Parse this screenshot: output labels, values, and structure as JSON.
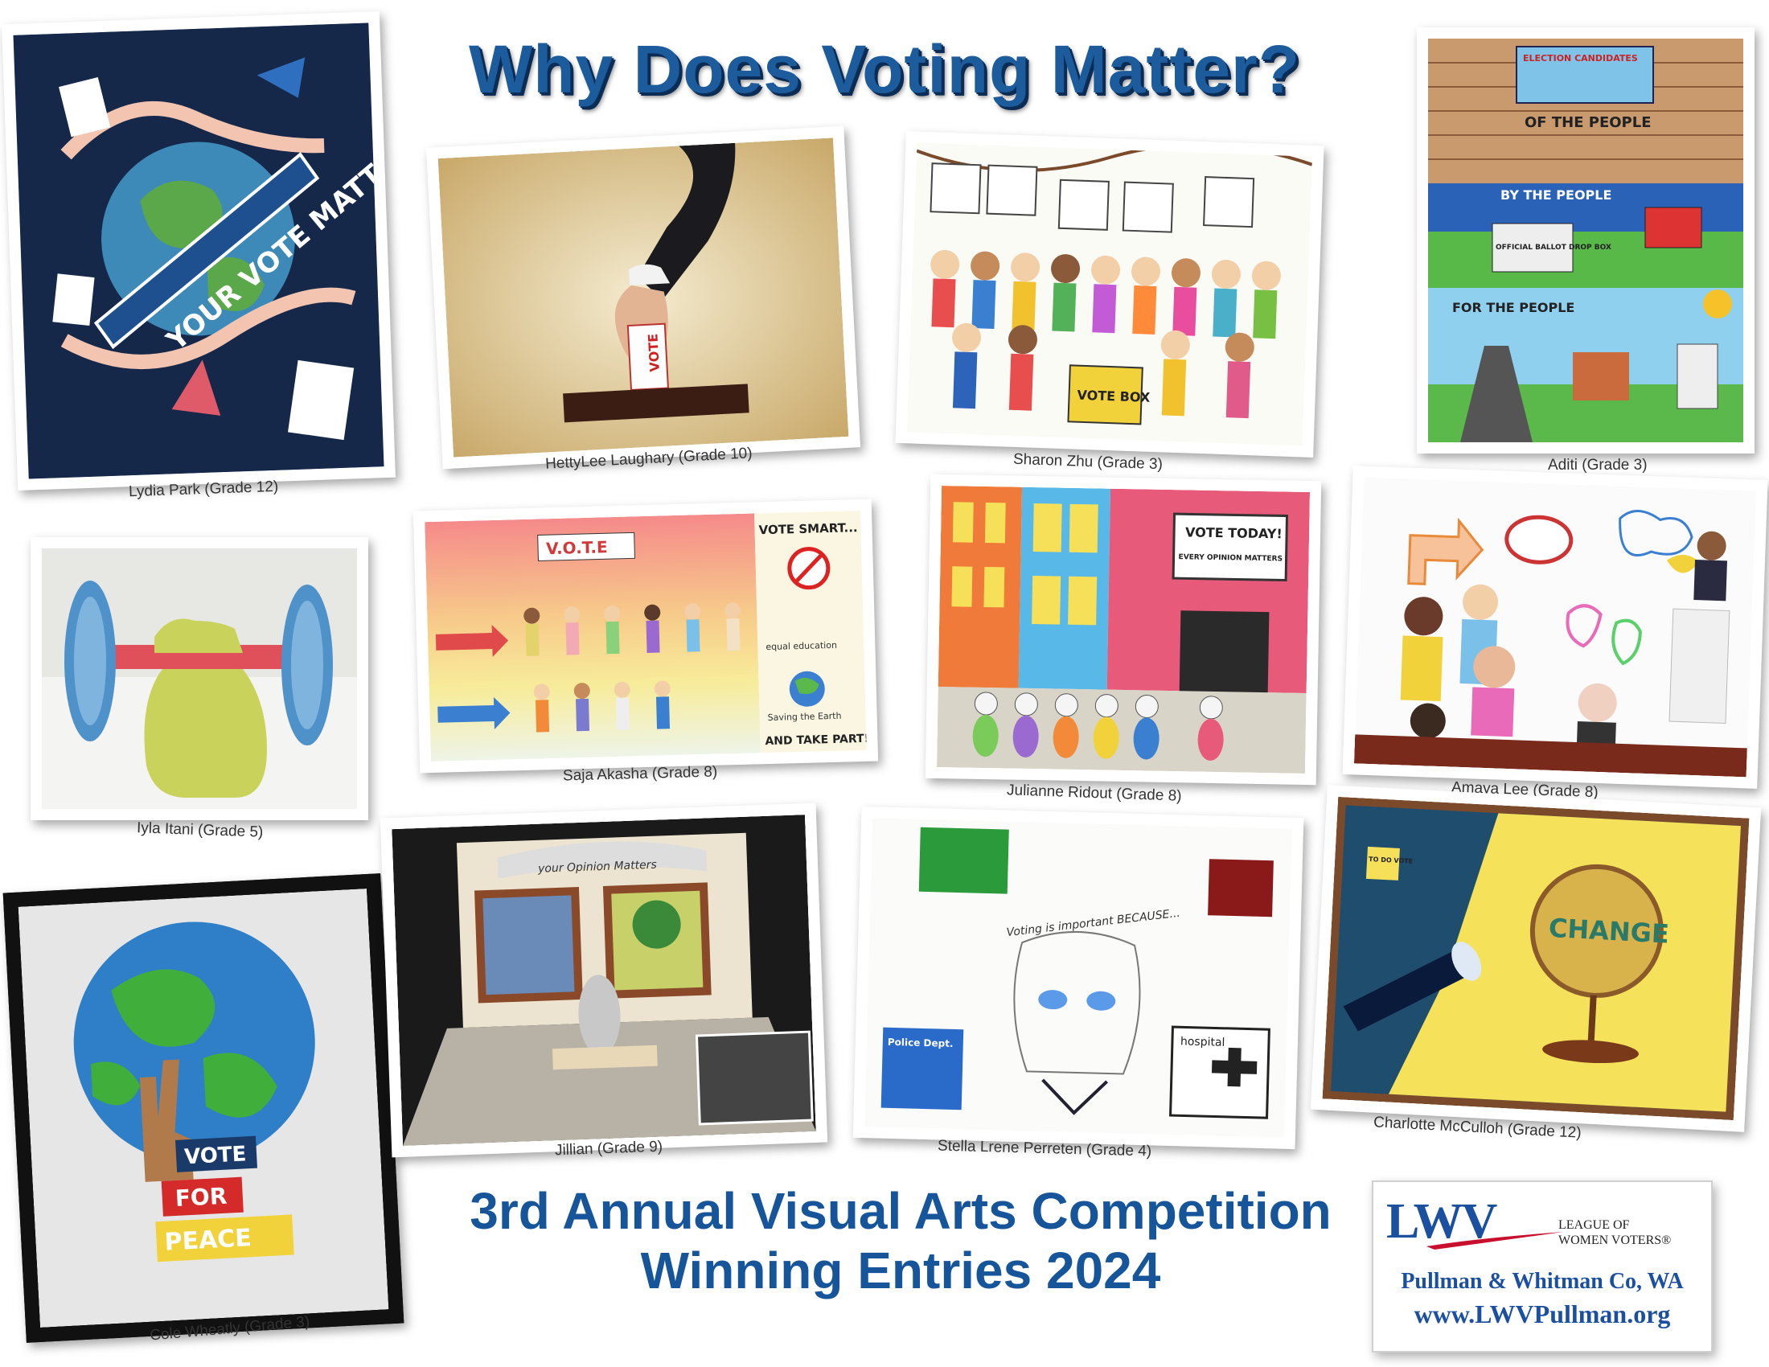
{
  "title": "Why Does Voting Matter?",
  "entries": [
    {
      "caption": "Lydia Park (Grade 12)"
    },
    {
      "caption": "HettyLee Laughary (Grade 10)"
    },
    {
      "caption": "Sharon Zhu (Grade 3)"
    },
    {
      "caption": "Aditi (Grade 3)"
    },
    {
      "caption": "Iyla Itani (Grade 5)"
    },
    {
      "caption": "Saja Akasha (Grade 8)"
    },
    {
      "caption": "Julianne Ridout (Grade 8)"
    },
    {
      "caption": "Amaya Lee (Grade 8)"
    },
    {
      "caption": "Cole Wheatly (Grade 3)"
    },
    {
      "caption": "Jillian (Grade 9)"
    },
    {
      "caption": "Stella Lrene Perreten (Grade 4)"
    },
    {
      "caption": "Charlotte McCulloh (Grade 12)"
    }
  ],
  "artwork_text": {
    "lydia": "YOUR VOTE MATTERS",
    "hetty": "VOTE",
    "sharon_box": "VOTE BOX",
    "aditi_banner": "ELECTION CANDIDATES",
    "aditi_1": "OF THE PEOPLE",
    "aditi_2": "BY THE PEOPLE",
    "aditi_3": "FOR THE PEOPLE",
    "aditi_box": "OFFICIAL BALLOT DROP BOX",
    "saja_sign": "V.O.T.E",
    "saja_right": "VOTE SMART...",
    "saja_bottom": "AND TAKE PART!",
    "saja_edu": "equal education",
    "saja_earth": "Saving the Earth",
    "julianne_sign1": "VOTE TODAY!",
    "julianne_sign2": "EVERY OPINION MATTERS",
    "jillian_banner": "your Opinion Matters",
    "stella_text": "Voting is important BECAUSE...",
    "stella_hosp": "hospital",
    "stella_police": "Police Dept.",
    "charlotte_globe": "CHANGE",
    "charlotte_note": "TO DO VOTE",
    "cole_1": "VOTE",
    "cole_2": "FOR",
    "cole_3": "PEACE"
  },
  "bottom_title": {
    "line1": "3rd Annual Visual Arts Competition",
    "line2": "Winning Entries 2024"
  },
  "logo": {
    "mark": "LWV",
    "org_line1": "LEAGUE OF",
    "org_line2": "WOMEN VOTERS®",
    "city": "Pullman & Whitman Co, WA",
    "url": "www.LWVPullman.org"
  },
  "colors": {
    "title_blue": "#1c5c9c",
    "logo_blue": "#1b4fa0",
    "logo_red": "#c8102e"
  }
}
